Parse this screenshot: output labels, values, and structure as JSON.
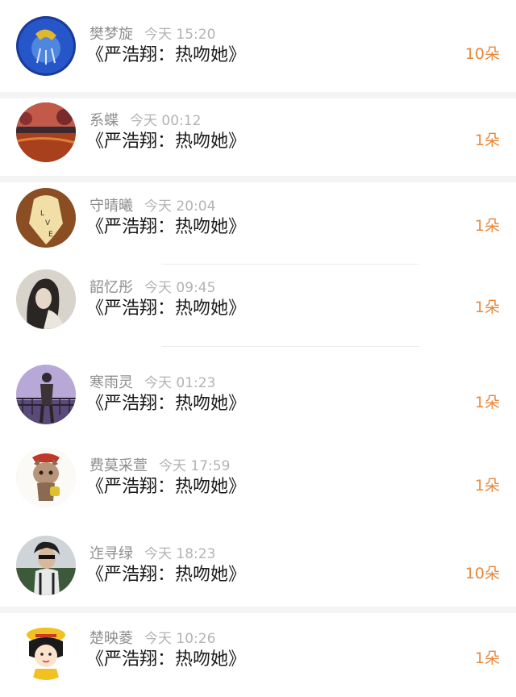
{
  "items": [
    {
      "name": "樊梦旋",
      "time": "今天 15:20",
      "title": "《严浩翔：热吻她》",
      "count": "10朵",
      "avatar_icon": "blue-crystal-avatar-icon"
    },
    {
      "name": "系蝶",
      "time": "今天 00:12",
      "title": "《严浩翔：热吻她》",
      "count": "1朵",
      "avatar_icon": "sunset-lake-avatar-icon"
    },
    {
      "name": "守晴曦",
      "time": "今天 20:04",
      "title": "《严浩翔：热吻她》",
      "count": "1朵",
      "avatar_icon": "paper-heart-love-avatar-icon"
    },
    {
      "name": "韶忆彤",
      "time": "今天 09:45",
      "title": "《严浩翔：热吻她》",
      "count": "1朵",
      "avatar_icon": "girl-portrait-avatar-icon"
    },
    {
      "name": "寒雨灵",
      "time": "今天 01:23",
      "title": "《严浩翔：热吻她》",
      "count": "1朵",
      "avatar_icon": "person-at-railing-avatar-icon"
    },
    {
      "name": "费莫采萱",
      "time": "今天 17:59",
      "title": "《严浩翔：热吻她》",
      "count": "1朵",
      "avatar_icon": "cartoon-cat-avatar-icon"
    },
    {
      "name": "迮寻绿",
      "time": "今天 18:23",
      "title": "《严浩翔：热吻她》",
      "count": "10朵",
      "avatar_icon": "boy-with-sunglasses-avatar-icon"
    },
    {
      "name": "楚映菱",
      "time": "今天 10:26",
      "title": "《严浩翔：热吻她》",
      "count": "1朵",
      "avatar_icon": "cartoon-girl-hat-avatar-icon"
    }
  ],
  "colors": {
    "count_orange": "#e8873a",
    "name_gray": "#8e8e8e",
    "time_gray": "#b3b3b3",
    "divider": "#f4f4f4"
  }
}
